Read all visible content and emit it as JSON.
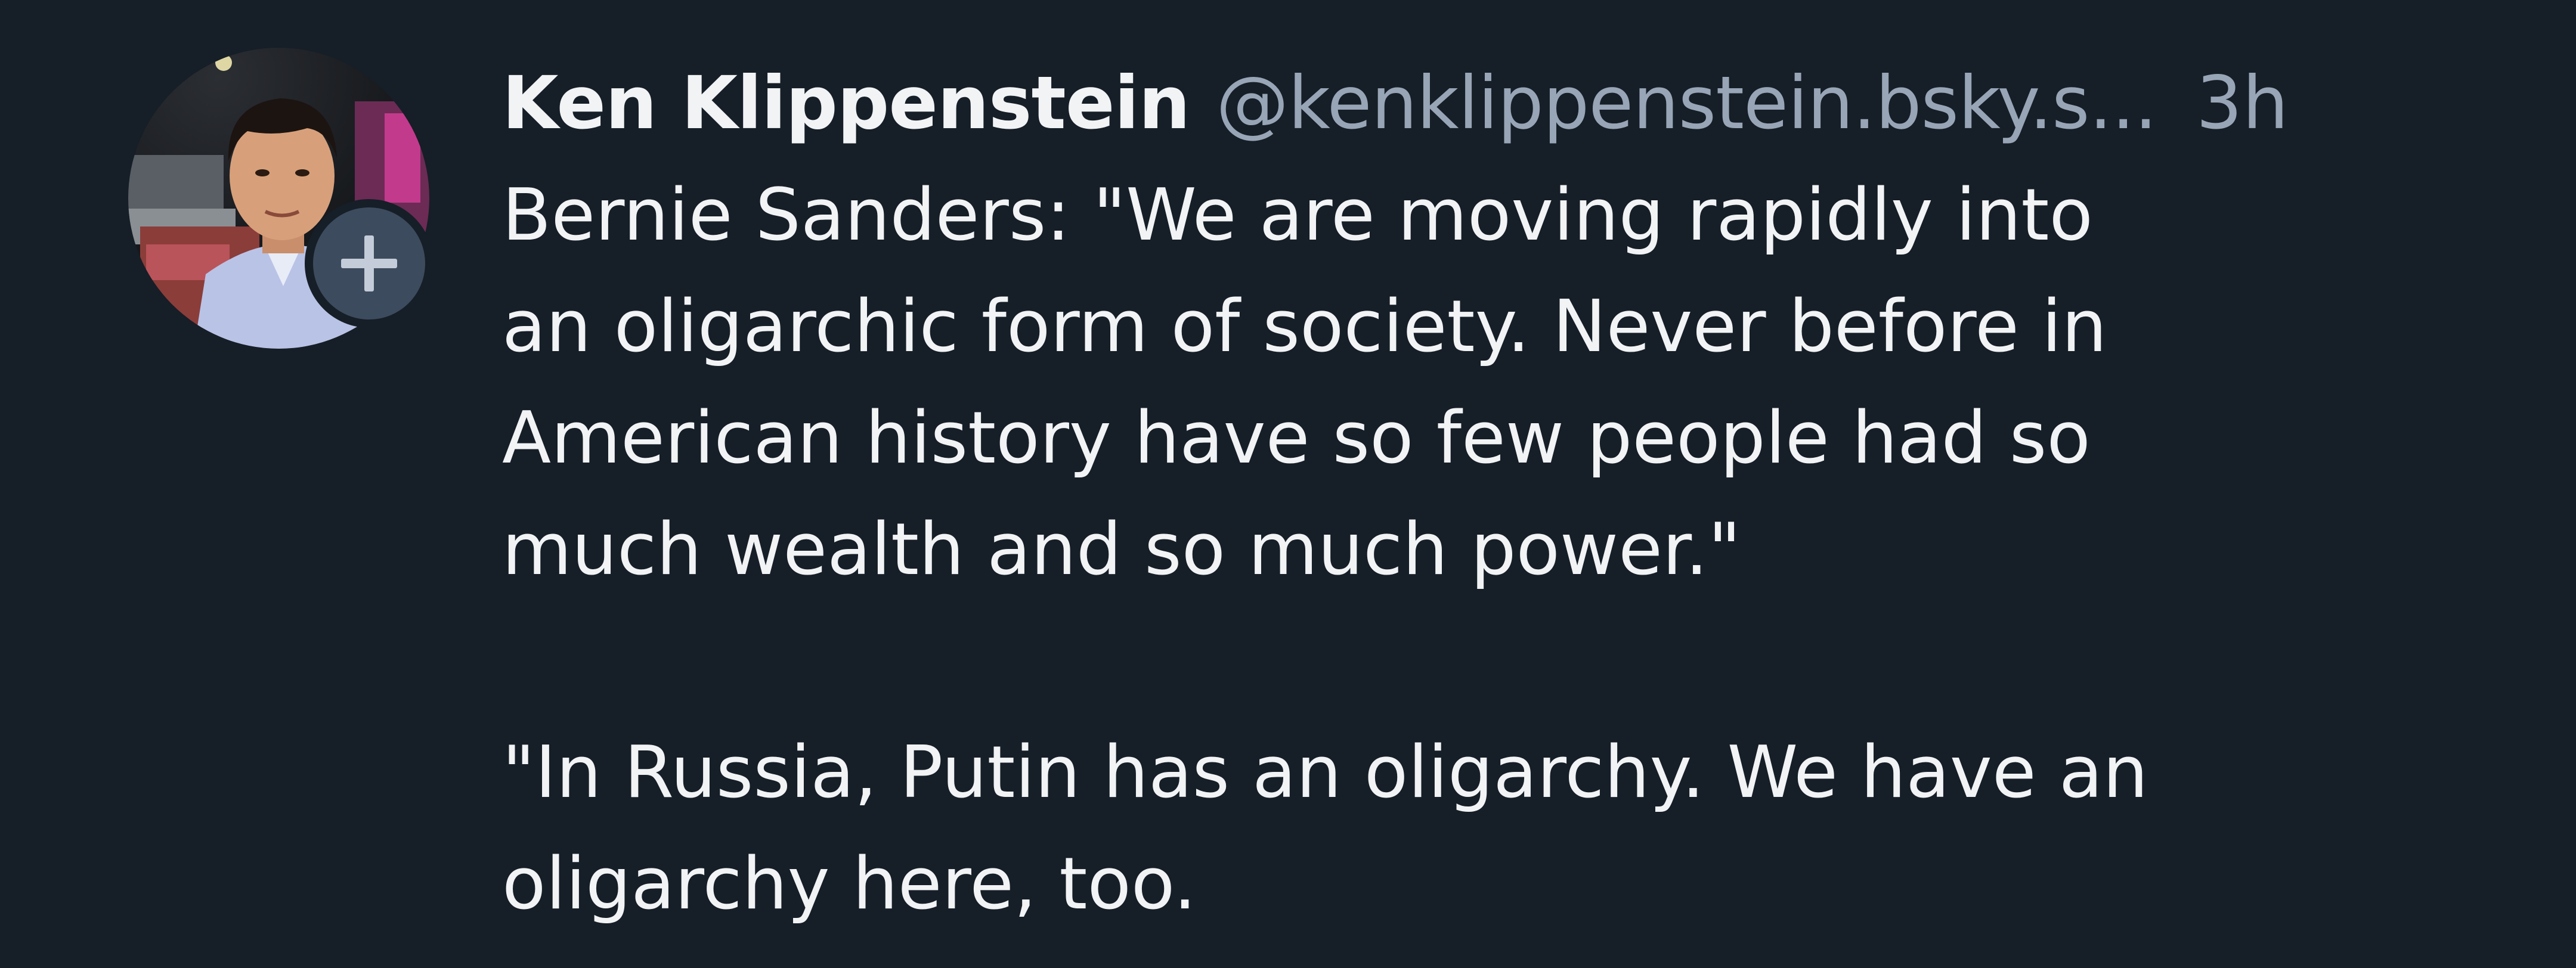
{
  "post": {
    "author": {
      "display_name": "Ken Klippenstein",
      "handle": "@kenklippenstein.bsky.s...",
      "avatar_icon": "user-avatar",
      "follow_icon": "plus-icon"
    },
    "timestamp": "3h",
    "body": {
      "paragraph_1": [
        "Bernie Sanders: \"We are moving rapidly into",
        "an oligarchic form of society. Never before in",
        "American history have so few people had so",
        "much wealth and so much power.\""
      ],
      "paragraph_2": [
        "\"In Russia, Putin has an oligarchy. We have an",
        "oligarchy here, too."
      ]
    }
  },
  "colors": {
    "background": "#161e27",
    "text_primary": "#f1f3f5",
    "text_secondary": "#97a5b6",
    "badge": "#3c4b5e"
  }
}
